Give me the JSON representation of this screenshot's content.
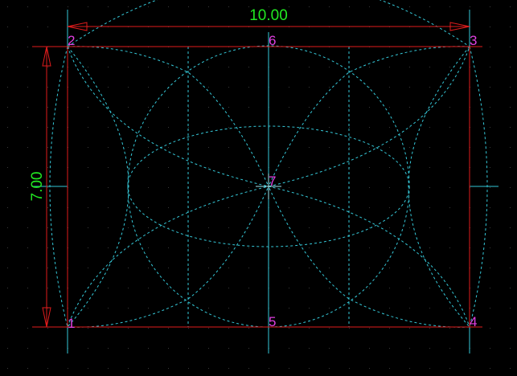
{
  "dimensions": {
    "horizontal": "10.00",
    "vertical": "7.00"
  },
  "points": [
    {
      "id": "1",
      "label": "1"
    },
    {
      "id": "2",
      "label": "2"
    },
    {
      "id": "3",
      "label": "3"
    },
    {
      "id": "4",
      "label": "4"
    },
    {
      "id": "5",
      "label": "5"
    },
    {
      "id": "6",
      "label": "6"
    },
    {
      "id": "7",
      "label": "7"
    }
  ],
  "colors": {
    "background": "#000000",
    "grid_dots": "#3a3a3a",
    "rectangle": "#e01c1c",
    "dimension_line": "#e01c1c",
    "dimension_text": "#22e822",
    "construction": "#35c8d8",
    "point_label": "#e040e0",
    "center_mark": "#9fe8f0"
  }
}
